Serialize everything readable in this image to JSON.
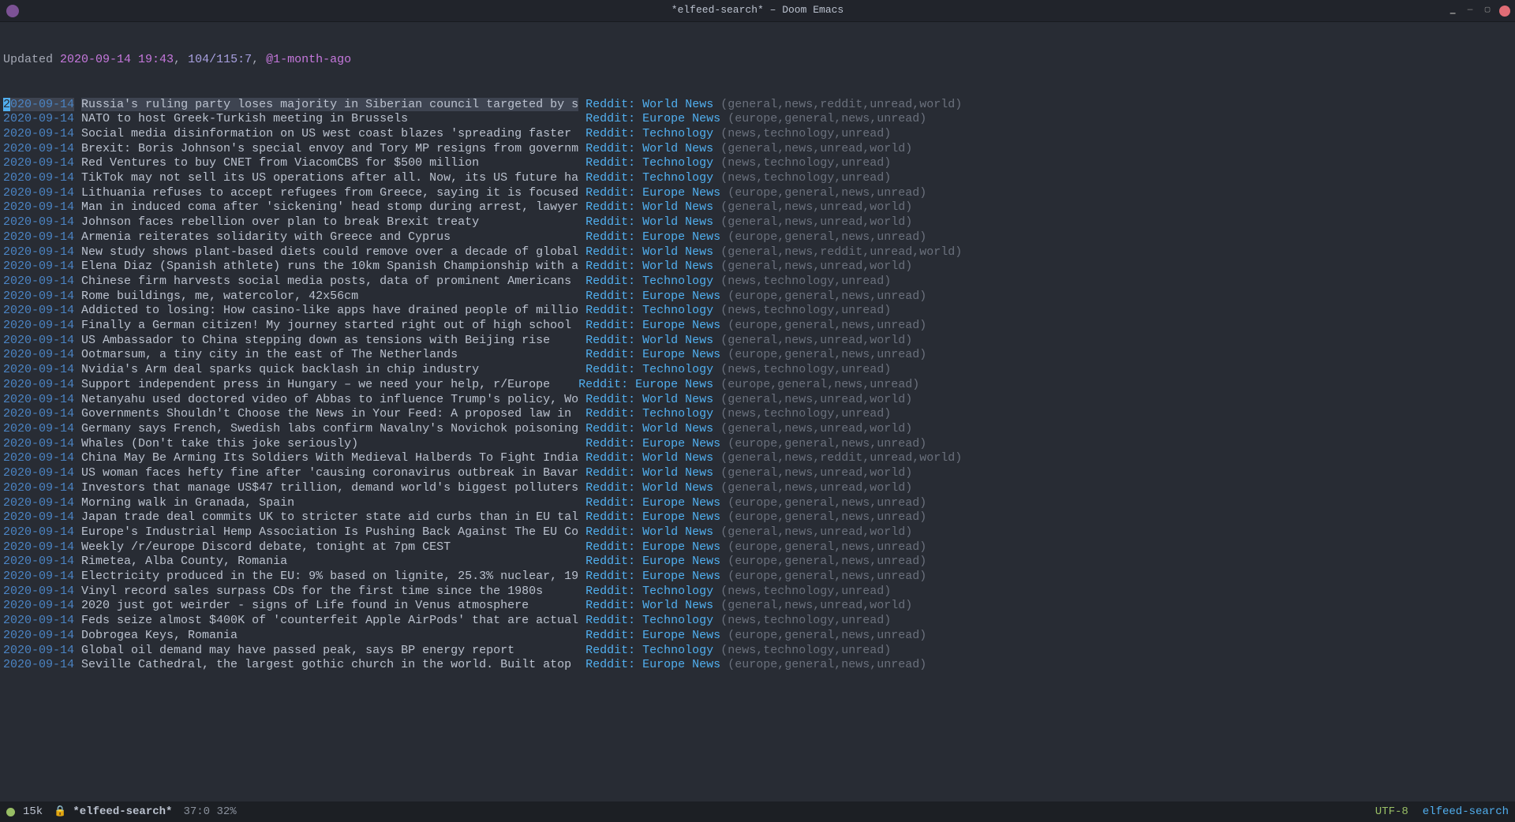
{
  "window": {
    "title": "*elfeed-search* – Doom Emacs"
  },
  "header": {
    "prefix": "Updated ",
    "date": "2020-09-14 19:43",
    "sep1": ", ",
    "count": "104/115:7",
    "sep2": ", ",
    "age": "@1-month-ago"
  },
  "feeds": {
    "world": "Reddit: World News",
    "europe": "Reddit: Europe News",
    "tech": "Reddit: Technology"
  },
  "tagsets": {
    "world_reddit": "(general,news,reddit,unread,world)",
    "world": "(general,news,unread,world)",
    "europe": "(europe,general,news,unread)",
    "tech": "(news,technology,unread)"
  },
  "entries": [
    {
      "date": "2020-09-14",
      "title": "Russia's ruling party loses majority in Siberian council targeted by s",
      "feed": "world",
      "tags": "world_reddit",
      "selected": true
    },
    {
      "date": "2020-09-14",
      "title": "NATO to host Greek-Turkish meeting in Brussels                        ",
      "feed": "europe",
      "tags": "europe"
    },
    {
      "date": "2020-09-14",
      "title": "Social media disinformation on US west coast blazes 'spreading faster ",
      "feed": "tech",
      "tags": "tech"
    },
    {
      "date": "2020-09-14",
      "title": "Brexit: Boris Johnson's special envoy and Tory MP resigns from governm",
      "feed": "world",
      "tags": "world"
    },
    {
      "date": "2020-09-14",
      "title": "Red Ventures to buy CNET from ViacomCBS for $500 million              ",
      "feed": "tech",
      "tags": "tech"
    },
    {
      "date": "2020-09-14",
      "title": "TikTok may not sell its US operations after all. Now, its US future ha",
      "feed": "tech",
      "tags": "tech"
    },
    {
      "date": "2020-09-14",
      "title": "Lithuania refuses to accept refugees from Greece, saying it is focused",
      "feed": "europe",
      "tags": "europe"
    },
    {
      "date": "2020-09-14",
      "title": "Man in induced coma after 'sickening' head stomp during arrest, lawyer",
      "feed": "world",
      "tags": "world"
    },
    {
      "date": "2020-09-14",
      "title": "Johnson faces rebellion over plan to break Brexit treaty              ",
      "feed": "world",
      "tags": "world"
    },
    {
      "date": "2020-09-14",
      "title": "Armenia reiterates solidarity with Greece and Cyprus                  ",
      "feed": "europe",
      "tags": "europe"
    },
    {
      "date": "2020-09-14",
      "title": "New study shows plant-based diets could remove over a decade of global",
      "feed": "world",
      "tags": "world_reddit"
    },
    {
      "date": "2020-09-14",
      "title": "Elena Diaz (Spanish athlete) runs the 10km Spanish Championship with a",
      "feed": "world",
      "tags": "world"
    },
    {
      "date": "2020-09-14",
      "title": "Chinese firm harvests social media posts, data of prominent Americans ",
      "feed": "tech",
      "tags": "tech"
    },
    {
      "date": "2020-09-14",
      "title": "Rome buildings, me, watercolor, 42x56cm                               ",
      "feed": "europe",
      "tags": "europe"
    },
    {
      "date": "2020-09-14",
      "title": "Addicted to losing: How casino-like apps have drained people of millio",
      "feed": "tech",
      "tags": "tech"
    },
    {
      "date": "2020-09-14",
      "title": "Finally a German citizen! My journey started right out of high school ",
      "feed": "europe",
      "tags": "europe"
    },
    {
      "date": "2020-09-14",
      "title": "US Ambassador to China stepping down as tensions with Beijing rise    ",
      "feed": "world",
      "tags": "world"
    },
    {
      "date": "2020-09-14",
      "title": "Ootmarsum, a tiny city in the east of The Netherlands                 ",
      "feed": "europe",
      "tags": "europe"
    },
    {
      "date": "2020-09-14",
      "title": "Nvidia's Arm deal sparks quick backlash in chip industry              ",
      "feed": "tech",
      "tags": "tech"
    },
    {
      "date": "2020-09-14",
      "title": "Support independent press in Hungary – we need your help, r/Europe   ",
      "feed": "europe",
      "tags": "europe"
    },
    {
      "date": "2020-09-14",
      "title": "Netanyahu used doctored video of Abbas to influence Trump's policy, Wo",
      "feed": "world",
      "tags": "world"
    },
    {
      "date": "2020-09-14",
      "title": "Governments Shouldn't Choose the News in Your Feed: A proposed law in ",
      "feed": "tech",
      "tags": "tech"
    },
    {
      "date": "2020-09-14",
      "title": "Germany says French, Swedish labs confirm Navalny's Novichok poisoning",
      "feed": "world",
      "tags": "world"
    },
    {
      "date": "2020-09-14",
      "title": "Whales (Don't take this joke seriously)                               ",
      "feed": "europe",
      "tags": "europe"
    },
    {
      "date": "2020-09-14",
      "title": "China May Be Arming Its Soldiers With Medieval Halberds To Fight India",
      "feed": "world",
      "tags": "world_reddit"
    },
    {
      "date": "2020-09-14",
      "title": "US woman faces hefty fine after 'causing coronavirus outbreak in Bavar",
      "feed": "world",
      "tags": "world"
    },
    {
      "date": "2020-09-14",
      "title": "Investors that manage US$47 trillion, demand world's biggest polluters",
      "feed": "world",
      "tags": "world"
    },
    {
      "date": "2020-09-14",
      "title": "Morning walk in Granada, Spain                                        ",
      "feed": "europe",
      "tags": "europe"
    },
    {
      "date": "2020-09-14",
      "title": "Japan trade deal commits UK to stricter state aid curbs than in EU tal",
      "feed": "europe",
      "tags": "europe"
    },
    {
      "date": "2020-09-14",
      "title": "Europe's Industrial Hemp Association Is Pushing Back Against The EU Co",
      "feed": "world",
      "tags": "world"
    },
    {
      "date": "2020-09-14",
      "title": "Weekly /r/europe Discord debate, tonight at 7pm CEST                  ",
      "feed": "europe",
      "tags": "europe"
    },
    {
      "date": "2020-09-14",
      "title": "Rimetea, Alba County, Romania                                         ",
      "feed": "europe",
      "tags": "europe"
    },
    {
      "date": "2020-09-14",
      "title": "Electricity produced in the EU: 9% based on lignite, 25.3% nuclear, 19",
      "feed": "europe",
      "tags": "europe"
    },
    {
      "date": "2020-09-14",
      "title": "Vinyl record sales surpass CDs for the first time since the 1980s     ",
      "feed": "tech",
      "tags": "tech"
    },
    {
      "date": "2020-09-14",
      "title": "2020 just got weirder - signs of Life found in Venus atmosphere       ",
      "feed": "world",
      "tags": "world"
    },
    {
      "date": "2020-09-14",
      "title": "Feds seize almost $400K of 'counterfeit Apple AirPods' that are actual",
      "feed": "tech",
      "tags": "tech"
    },
    {
      "date": "2020-09-14",
      "title": "Dobrogea Keys, Romania                                                ",
      "feed": "europe",
      "tags": "europe"
    },
    {
      "date": "2020-09-14",
      "title": "Global oil demand may have passed peak, says BP energy report         ",
      "feed": "tech",
      "tags": "tech"
    },
    {
      "date": "2020-09-14",
      "title": "Seville Cathedral, the largest gothic church in the world. Built atop ",
      "feed": "europe",
      "tags": "europe"
    }
  ],
  "modeline": {
    "size": "15k",
    "buffer": "*elfeed-search*",
    "position": "37:0 32%",
    "encoding": "UTF-8",
    "mode": "elfeed-search"
  }
}
